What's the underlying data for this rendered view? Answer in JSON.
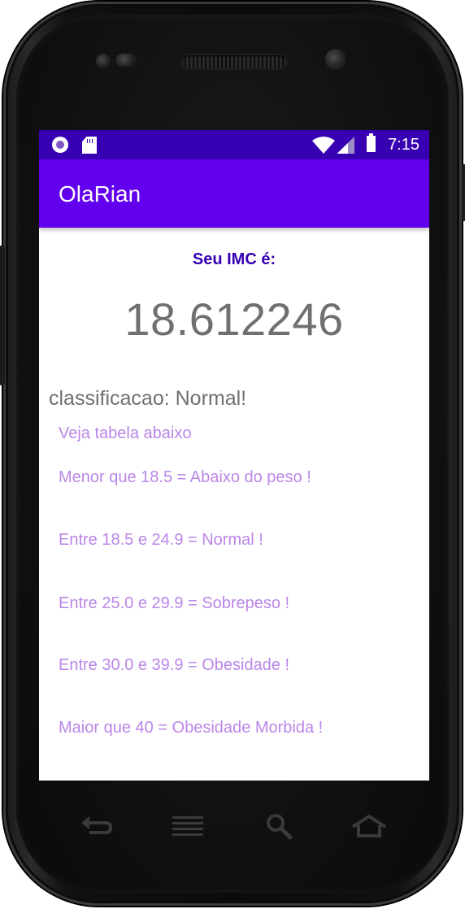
{
  "status_bar": {
    "time": "7:15",
    "icons": [
      "record-icon",
      "sd-card-icon",
      "wifi-icon",
      "signal-icon",
      "battery-icon"
    ],
    "background": "#3700b3"
  },
  "app_bar": {
    "title": "OlaRian",
    "background": "#6200ee"
  },
  "main": {
    "imc_label": "Seu IMC é:",
    "imc_value": "18.612246",
    "classification": "classificacao: Normal!",
    "table_header": "Veja tabela abaixo",
    "table_rows": [
      "Menor que 18.5 = Abaixo do peso !",
      "Entre 18.5 e 24.9 = Normal !",
      "Entre 25.0 e 29.9 = Sobrepeso !",
      "Entre 30.0 e 39.9 = Obesidade !",
      "Maior que 40 = Obesidade Morbida !"
    ],
    "colors": {
      "label": "#3700b3",
      "value": "#707070",
      "table_text": "#bb86e8"
    }
  },
  "nav_bar": {
    "buttons": [
      "back-icon",
      "menu-icon",
      "search-icon",
      "home-icon"
    ]
  }
}
